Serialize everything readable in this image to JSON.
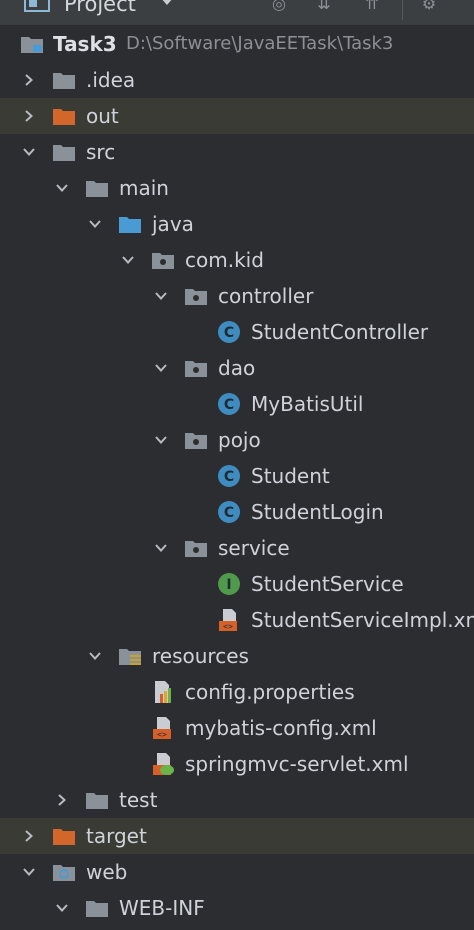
{
  "header": {
    "title": "Project",
    "toolbar_icons": [
      "globe-icon",
      "collapse-icon",
      "expand-icon",
      "gear-icon"
    ]
  },
  "colors": {
    "background": "#2b2d30",
    "folder_gray": "#8a9199",
    "folder_orange": "#d3672a",
    "folder_blue": "#4a9bd3",
    "class_icon": "#3f8dc0",
    "interface_icon": "#4f9a4b",
    "xml_icon": "#d5602a",
    "highlight_row": "#3a3b34"
  },
  "tree": {
    "root": {
      "name": "Task3",
      "path": "D:\\Software\\JavaEETask\\Task3"
    },
    "items": [
      {
        "label": ".idea",
        "icon": "folder-icon"
      },
      {
        "label": "out",
        "icon": "excluded-folder-icon"
      },
      {
        "label": "src",
        "icon": "folder-icon"
      },
      {
        "label": "main",
        "icon": "folder-icon"
      },
      {
        "label": "java",
        "icon": "source-folder-icon"
      },
      {
        "label": "com.kid",
        "icon": "package-icon"
      },
      {
        "label": "controller",
        "icon": "package-icon"
      },
      {
        "label": "StudentController",
        "icon": "class-icon"
      },
      {
        "label": "dao",
        "icon": "package-icon"
      },
      {
        "label": "MyBatisUtil",
        "icon": "class-icon"
      },
      {
        "label": "pojo",
        "icon": "package-icon"
      },
      {
        "label": "Student",
        "icon": "class-icon"
      },
      {
        "label": "StudentLogin",
        "icon": "class-icon"
      },
      {
        "label": "service",
        "icon": "package-icon"
      },
      {
        "label": "StudentService",
        "icon": "interface-icon"
      },
      {
        "label": "StudentServiceImpl.xml",
        "icon": "xml-file-icon"
      },
      {
        "label": "resources",
        "icon": "resources-folder-icon"
      },
      {
        "label": "config.properties",
        "icon": "properties-file-icon"
      },
      {
        "label": "mybatis-config.xml",
        "icon": "xml-file-icon"
      },
      {
        "label": "springmvc-servlet.xml",
        "icon": "spring-xml-icon"
      },
      {
        "label": "test",
        "icon": "folder-icon"
      },
      {
        "label": "target",
        "icon": "excluded-folder-icon"
      },
      {
        "label": "web",
        "icon": "web-folder-icon"
      },
      {
        "label": "WEB-INF",
        "icon": "folder-icon"
      }
    ]
  }
}
